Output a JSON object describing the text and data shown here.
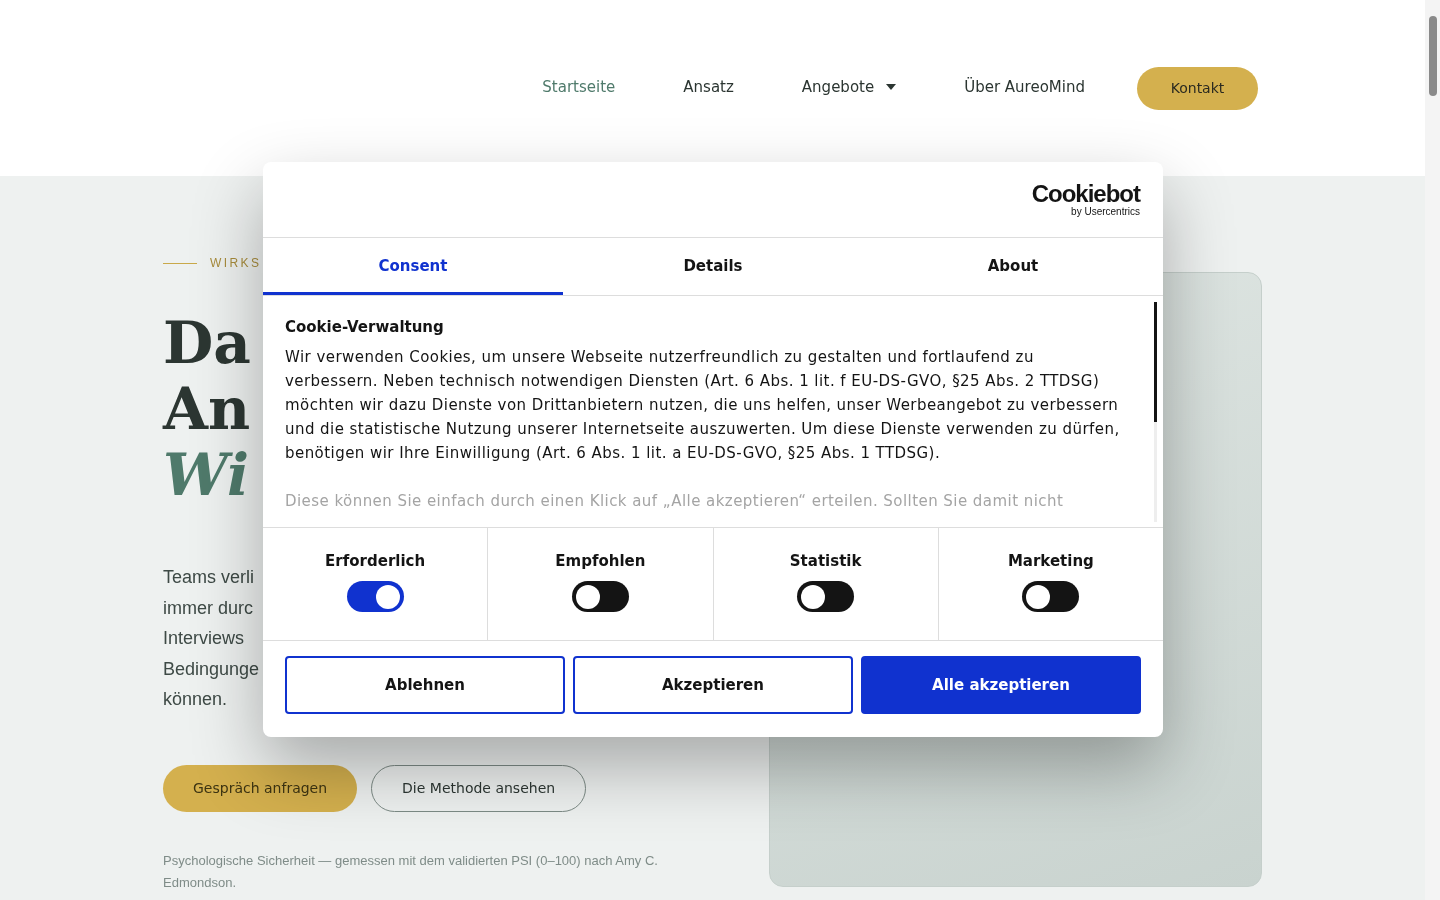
{
  "nav": {
    "items": [
      {
        "label": "Startseite",
        "selected": true,
        "kind": "link"
      },
      {
        "label": "Ansatz",
        "selected": false,
        "kind": "link"
      },
      {
        "label": "Angebote",
        "selected": false,
        "kind": "dropdown"
      },
      {
        "label": "Über AureoMind",
        "selected": false,
        "kind": "link"
      }
    ],
    "cta": "Kontakt"
  },
  "hero": {
    "eyebrow": "WIRKS",
    "heading": [
      "Da",
      "An",
      "Wi"
    ],
    "paragraph": [
      "Teams verli",
      "immer durc",
      "Interviews",
      "Bedingunge",
      "können."
    ],
    "buttons": [
      {
        "label": "Gespräch anfragen",
        "kind": "primary"
      },
      {
        "label": "Die Methode ansehen",
        "kind": "secondary"
      }
    ],
    "footnote": "Psychologische Sicherheit — gemessen mit dem validierten PSI (0–100) nach Amy C. Edmondson."
  },
  "consent_dialog": {
    "logo": {
      "name": "Cookiebot",
      "tagline": "by Usercentrics"
    },
    "tabs": [
      {
        "label": "Consent",
        "selected": true
      },
      {
        "label": "Details",
        "selected": false
      },
      {
        "label": "About",
        "selected": false
      }
    ],
    "title": "Cookie-Verwaltung",
    "text": "Wir verwenden Cookies, um unsere Webseite nutzerfreundlich zu gestalten und fortlaufend zu verbessern. Neben technisch notwendigen Diensten (Art. 6 Abs. 1 lit. f EU-DS-GVO, §25 Abs. 2 TTDSG) möchten wir dazu Dienste von Drittanbietern nutzen, die uns helfen, unser Werbeangebot zu verbessern und die statistische Nutzung unserer Internetseite auszuwerten. Um diese Dienste verwenden zu dürfen, benötigen wir Ihre Einwilligung (Art. 6 Abs. 1 lit. a EU-DS-GVO, §25 Abs. 1 TTDSG).",
    "faded_text": "Diese können Sie einfach durch einen Klick auf „Alle akzeptieren“ erteilen. Sollten Sie damit nicht",
    "categories": [
      {
        "label": "Erforderlich",
        "on": true
      },
      {
        "label": "Empfohlen",
        "on": false
      },
      {
        "label": "Statistik",
        "on": false
      },
      {
        "label": "Marketing",
        "on": false
      }
    ],
    "buttons": [
      {
        "label": "Ablehnen",
        "kind": "outline"
      },
      {
        "label": "Akzeptieren",
        "kind": "outline"
      },
      {
        "label": "Alle akzeptieren",
        "kind": "filled"
      }
    ]
  }
}
